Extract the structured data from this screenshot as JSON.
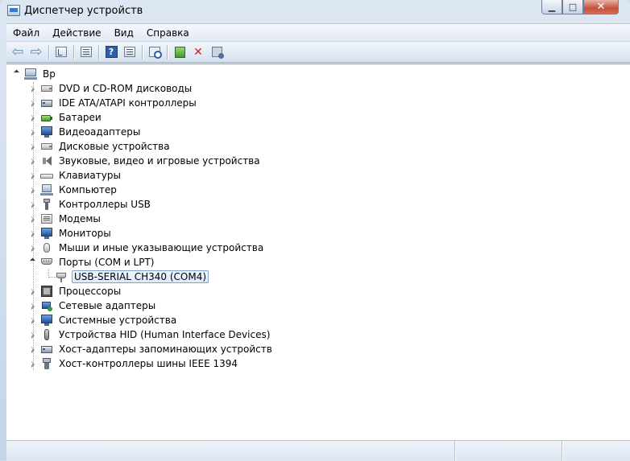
{
  "window": {
    "title": "Диспетчер устройств",
    "controls": {
      "minimize": "▁",
      "maximize": "□",
      "close": "✕"
    }
  },
  "menu": {
    "items": [
      "Файл",
      "Действие",
      "Вид",
      "Справка"
    ]
  },
  "toolbar": {
    "buttons": [
      "back-icon",
      "forward-icon",
      "show-hide-tree-icon",
      "properties-icon",
      "help-icon",
      "scan-hardware-icon",
      "update-driver-icon",
      "uninstall-icon",
      "disable-icon"
    ]
  },
  "tree": {
    "root": {
      "label": "Bp",
      "icon": "computer-icon"
    },
    "categories": [
      {
        "label": "DVD и CD-ROM дисководы",
        "icon": "dvd-drive-icon"
      },
      {
        "label": "IDE ATA/ATAPI контроллеры",
        "icon": "ide-controller-icon"
      },
      {
        "label": "Батареи",
        "icon": "battery-icon"
      },
      {
        "label": "Видеоадаптеры",
        "icon": "display-adapter-icon"
      },
      {
        "label": "Дисковые устройства",
        "icon": "disk-drive-icon"
      },
      {
        "label": "Звуковые, видео и игровые устройства",
        "icon": "sound-icon"
      },
      {
        "label": "Клавиатуры",
        "icon": "keyboard-icon"
      },
      {
        "label": "Компьютер",
        "icon": "computer-icon"
      },
      {
        "label": "Контроллеры USB",
        "icon": "usb-icon"
      },
      {
        "label": "Модемы",
        "icon": "modem-icon"
      },
      {
        "label": "Мониторы",
        "icon": "monitor-icon"
      },
      {
        "label": "Мыши и иные указывающие устройства",
        "icon": "mouse-icon"
      },
      {
        "label": "Порты (COM и LPT)",
        "icon": "port-icon",
        "expanded": true
      },
      {
        "label": "Процессоры",
        "icon": "processor-icon"
      },
      {
        "label": "Сетевые адаптеры",
        "icon": "network-adapter-icon"
      },
      {
        "label": "Системные устройства",
        "icon": "system-device-icon"
      },
      {
        "label": "Устройства HID (Human Interface Devices)",
        "icon": "hid-icon"
      },
      {
        "label": "Хост-адаптеры запоминающих устройств",
        "icon": "storage-controller-icon"
      },
      {
        "label": "Хост-контроллеры шины IEEE 1394",
        "icon": "ieee1394-icon"
      }
    ],
    "ports_child": {
      "label": "USB-SERIAL CH340 (COM4)",
      "icon": "com-port-icon",
      "selected": true
    }
  }
}
